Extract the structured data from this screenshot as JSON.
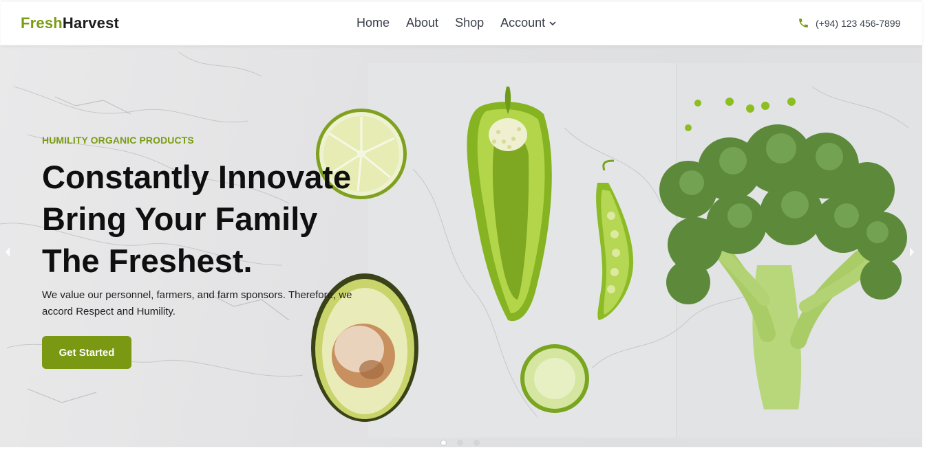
{
  "brand": {
    "part1": "Fresh",
    "part2": "Harvest",
    "accent_color": "#7a9c12"
  },
  "nav": {
    "items": [
      {
        "label": "Home"
      },
      {
        "label": "About"
      },
      {
        "label": "Shop"
      },
      {
        "label": "Account",
        "has_dropdown": true
      }
    ],
    "phone": "(+94) 123 456-7899",
    "phone_icon": "phone-icon"
  },
  "hero": {
    "eyebrow": "HUMILITY ORGANIC PRODUCTS",
    "headline_lines": [
      "Constantly Innovate",
      "Bring Your Family",
      "The Freshest."
    ],
    "description": "We value our personnel, farmers, and farm sponsors. Therefore, we accord Respect and Humility.",
    "cta_label": "Get Started",
    "cta_color": "#7b9812",
    "slides_count": 3,
    "active_slide": 1
  }
}
